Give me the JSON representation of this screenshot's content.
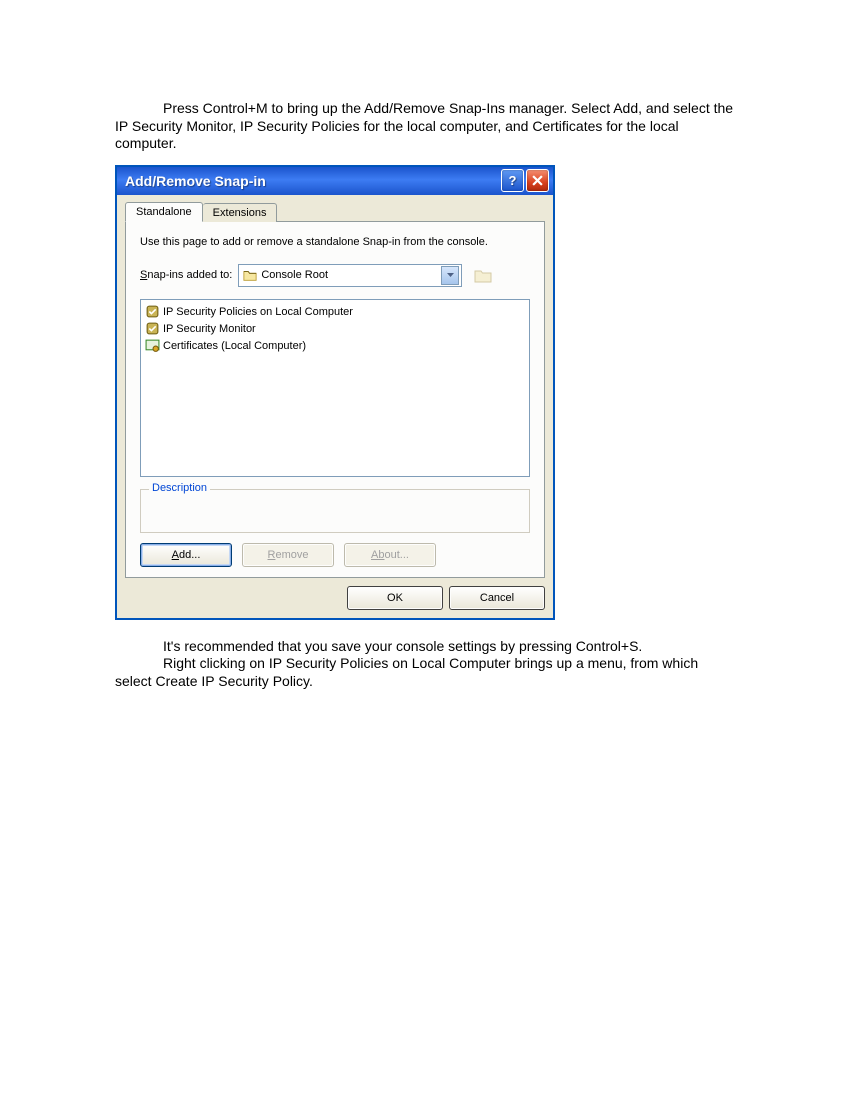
{
  "doc": {
    "para1": "Press Control+M to bring up the Add/Remove Snap-Ins manager.  Select Add, and select the IP Security Monitor, IP Security Policies for the local computer, and Certificates for the local computer.",
    "para2": "It's recommended that you save your console settings by pressing Control+S.",
    "para3": "Right clicking on IP Security Policies on Local Computer brings up a menu, from which select Create IP Security Policy."
  },
  "dialog": {
    "title": "Add/Remove Snap-in",
    "tabs": {
      "standalone": "Standalone",
      "extensions": "Extensions"
    },
    "desc": "Use this page to add or remove a standalone Snap-in from the console.",
    "snapins_label_pre": "S",
    "snapins_label_post": "nap-ins added to:",
    "dropdown_value": "Console Root",
    "items": [
      "IP Security Policies on Local Computer",
      "IP Security Monitor",
      "Certificates (Local Computer)"
    ],
    "group_label": "Description",
    "buttons": {
      "add_pre": "A",
      "add_post": "dd...",
      "remove_pre": "R",
      "remove_post": "emove",
      "about_pre": "Ab",
      "about_post": "out...",
      "ok": "OK",
      "cancel": "Cancel"
    }
  }
}
